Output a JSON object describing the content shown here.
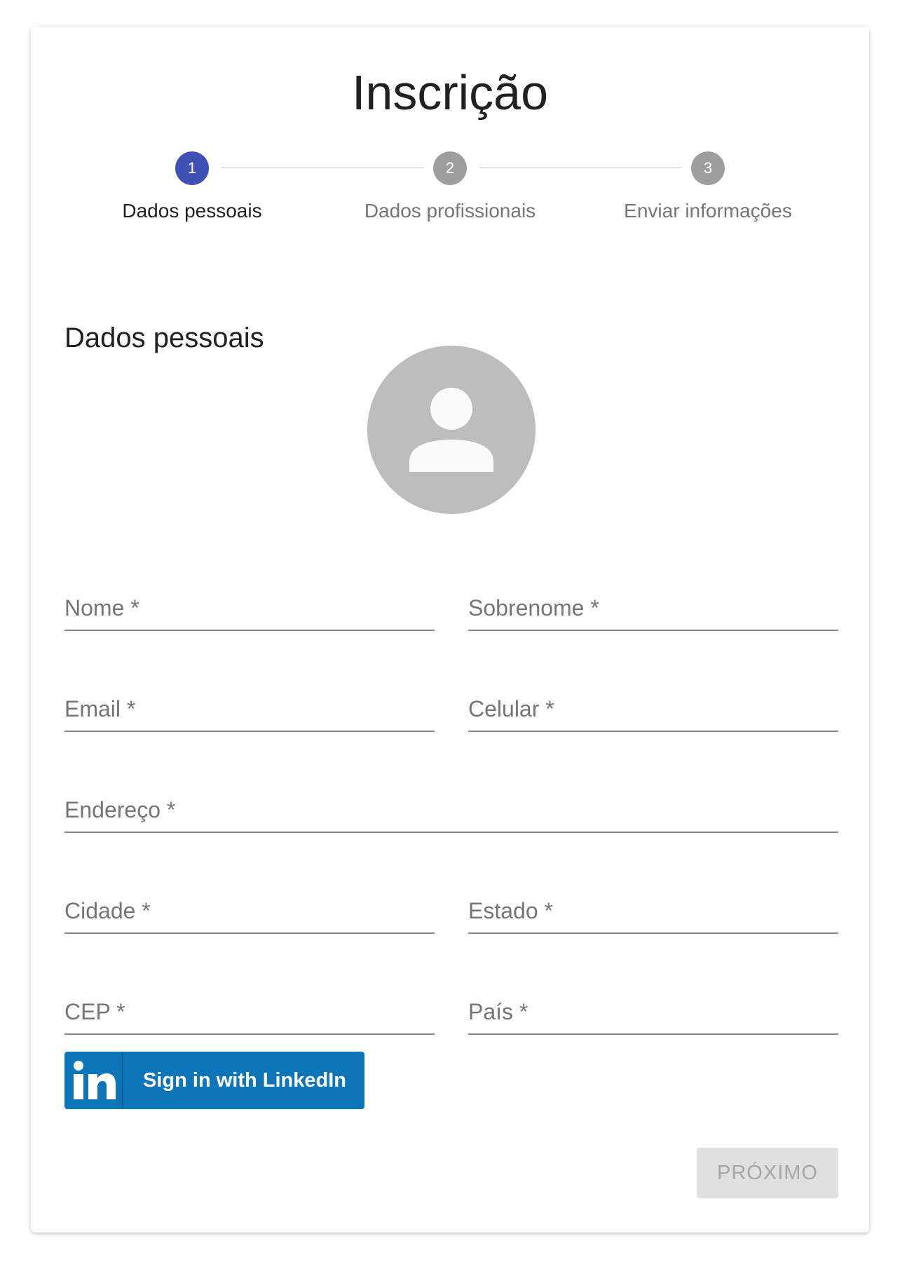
{
  "page": {
    "title": "Inscrição"
  },
  "stepper": {
    "steps": [
      {
        "number": "1",
        "label": "Dados pessoais",
        "state": "active"
      },
      {
        "number": "2",
        "label": "Dados profissionais",
        "state": "inactive"
      },
      {
        "number": "3",
        "label": "Enviar informações",
        "state": "inactive"
      }
    ],
    "active_color": "#3f51b5",
    "inactive_color": "#9e9e9e"
  },
  "form": {
    "section_title": "Dados pessoais",
    "avatar_icon": "person-icon",
    "fields": {
      "nome": {
        "label": "Nome *",
        "value": ""
      },
      "sobrenome": {
        "label": "Sobrenome *",
        "value": ""
      },
      "email": {
        "label": "Email *",
        "value": ""
      },
      "celular": {
        "label": "Celular *",
        "value": ""
      },
      "endereco": {
        "label": "Endereço *",
        "value": ""
      },
      "cidade": {
        "label": "Cidade *",
        "value": ""
      },
      "estado": {
        "label": "Estado *",
        "value": ""
      },
      "cep": {
        "label": "CEP *",
        "value": ""
      },
      "pais": {
        "label": "País *",
        "value": ""
      }
    }
  },
  "linkedin": {
    "logo_text": "in",
    "label": "Sign in with LinkedIn",
    "color": "#0e76b8"
  },
  "actions": {
    "next_label": "PRÓXIMO",
    "next_disabled": true
  }
}
